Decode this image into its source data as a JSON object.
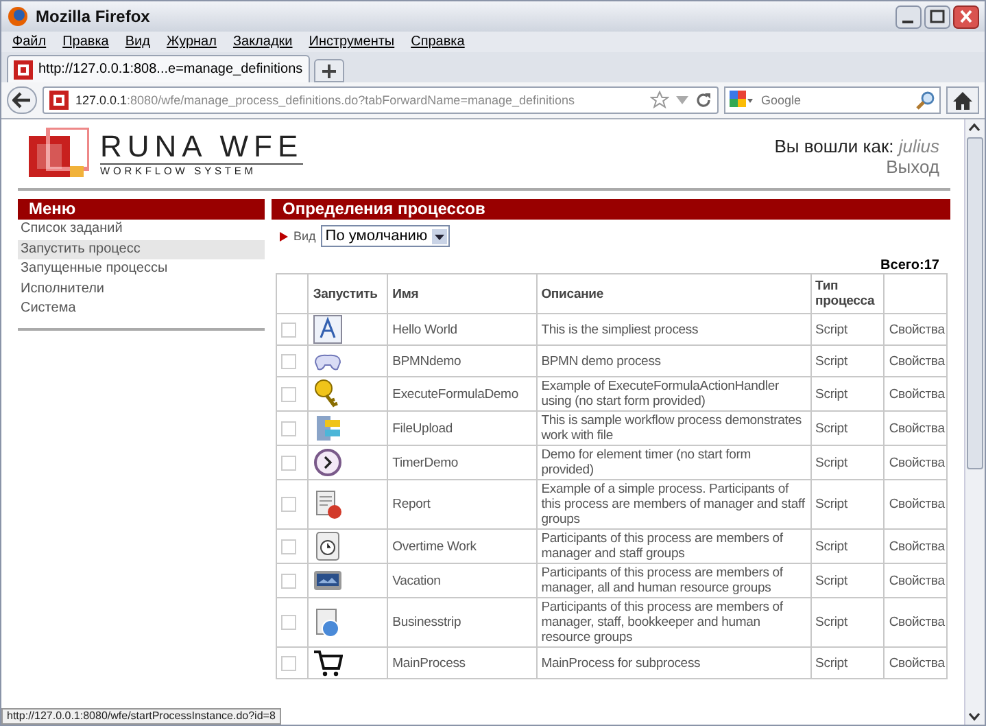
{
  "window": {
    "title": "Mozilla Firefox"
  },
  "menu_bar": [
    "Файл",
    "Правка",
    "Вид",
    "Журнал",
    "Закладки",
    "Инструменты",
    "Справка"
  ],
  "tab": {
    "title": "http://127.0.0.1:808...e=manage_definitions",
    "selected": true
  },
  "address_bar": {
    "host": "127.0.0.1",
    "path": ":8080/wfe/manage_process_definitions.do?tabForwardName=manage_definitions"
  },
  "search": {
    "placeholder": "Google"
  },
  "header": {
    "logo_title": "RUNA WFE",
    "logo_subtitle": "WORKFLOW SYSTEM",
    "user_label": "Вы вошли как:",
    "user_name": "julius",
    "logout": "Выход"
  },
  "sidebar": {
    "title": "Меню",
    "items": [
      {
        "label": "Список заданий",
        "selected": false
      },
      {
        "label": "Запустить процесс",
        "selected": true
      },
      {
        "label": "Запущенные процессы",
        "selected": false
      },
      {
        "label": "Исполнители",
        "selected": false
      },
      {
        "label": "Система",
        "selected": false
      }
    ]
  },
  "main": {
    "title": "Определения процессов",
    "view_label": "Вид",
    "view_value": "По умолчанию",
    "total": "Всего:17",
    "table": {
      "columns": [
        "Запустить",
        "Имя",
        "Описание",
        "Тип процесса"
      ],
      "rows": [
        {
          "checked": false,
          "name": "Hello World",
          "description": "This is the simpliest process",
          "type": "Script",
          "action": "Свойства"
        },
        {
          "checked": false,
          "name": "BPMNdemo",
          "description": "BPMN demo process",
          "type": "Script",
          "action": "Свойства"
        },
        {
          "checked": false,
          "name": "ExecuteFormulaDemo",
          "description": "Example of ExecuteFormulaActionHandler using (no start form provided)",
          "type": "Script",
          "action": "Свойства"
        },
        {
          "checked": false,
          "name": "FileUpload",
          "description": "This is sample workflow process demonstrates work with file",
          "type": "Script",
          "action": "Свойства"
        },
        {
          "checked": false,
          "name": "TimerDemo",
          "description": "Demo for element timer (no start form provided)",
          "type": "Script",
          "action": "Свойства"
        },
        {
          "checked": false,
          "name": "Report",
          "description": "Example of a simple process. Participants of this process are members of manager and staff groups",
          "type": "Script",
          "action": "Свойства"
        },
        {
          "checked": false,
          "name": "Overtime Work",
          "description": "Participants of this process are members of manager and staff groups",
          "type": "Script",
          "action": "Свойства"
        },
        {
          "checked": false,
          "name": "Vacation",
          "description": "Participants of this process are members of manager, all and human resource groups",
          "type": "Script",
          "action": "Свойства"
        },
        {
          "checked": false,
          "name": "Businesstrip",
          "description": "Participants of this process are members of manager, staff, bookkeeper and human resource groups",
          "type": "Script",
          "action": "Свойства"
        },
        {
          "checked": false,
          "name": "MainProcess",
          "description": "MainProcess for subprocess",
          "type": "Script",
          "action": "Свойства"
        }
      ]
    }
  },
  "status_bar": "http://127.0.0.1:8080/wfe/startProcessInstance.do?id=8"
}
